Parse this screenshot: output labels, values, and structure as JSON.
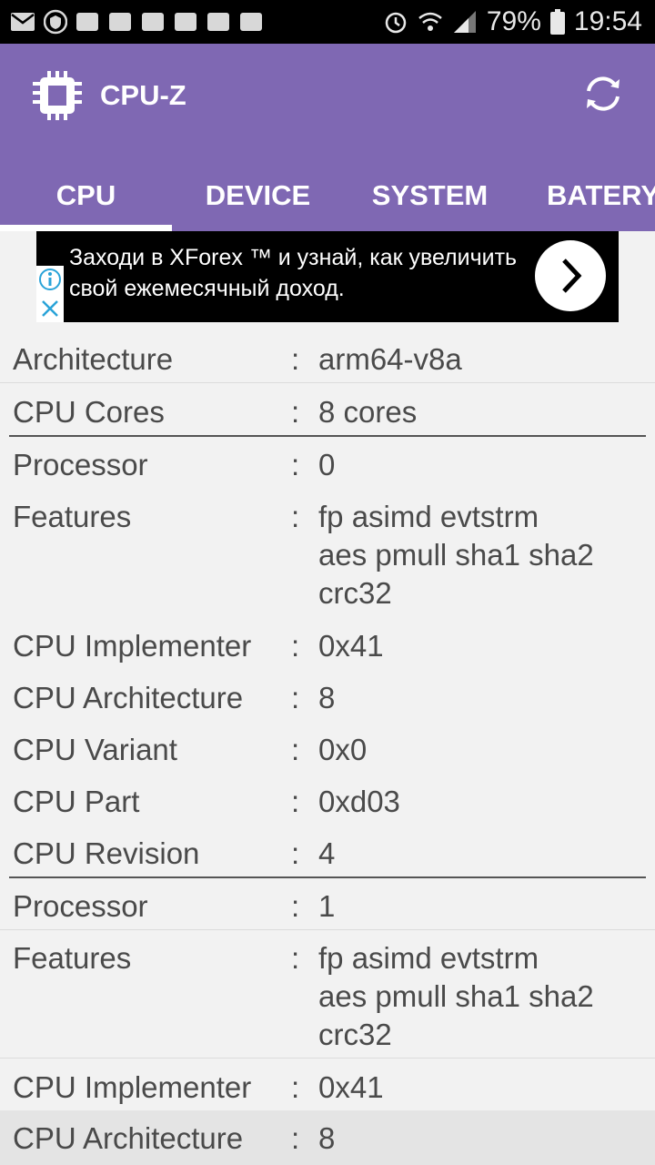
{
  "status_bar": {
    "battery": "79%",
    "time": "19:54"
  },
  "app": {
    "title": "CPU-Z"
  },
  "tabs": [
    {
      "label": "CPU"
    },
    {
      "label": "DEVICE"
    },
    {
      "label": "SYSTEM"
    },
    {
      "label": "BATERY"
    }
  ],
  "ad": {
    "text": "Заходи в XForex ™ и узнай, как увеличить свой ежемесячный доход."
  },
  "rows": [
    {
      "key": "Architecture",
      "value": "arm64-v8a"
    },
    {
      "key": "CPU Cores",
      "value": "8 cores"
    },
    {
      "key": "Processor",
      "value": "0"
    },
    {
      "key": "Features",
      "value": "fp asimd evtstrm\naes pmull sha1 sha2\ncrc32"
    },
    {
      "key": "CPU Implementer",
      "value": "0x41"
    },
    {
      "key": "CPU Architecture",
      "value": "8"
    },
    {
      "key": "CPU Variant",
      "value": "0x0"
    },
    {
      "key": "CPU Part",
      "value": "0xd03"
    },
    {
      "key": "CPU Revision",
      "value": "4"
    },
    {
      "key": "Processor",
      "value": "1"
    },
    {
      "key": "Features",
      "value": "fp asimd evtstrm\naes pmull sha1 sha2\ncrc32"
    },
    {
      "key": "CPU Implementer",
      "value": "0x41"
    },
    {
      "key": "CPU Architecture",
      "value": "8"
    }
  ],
  "colors": {
    "appbar": "#7f68b3",
    "accent": "#ffffff"
  }
}
